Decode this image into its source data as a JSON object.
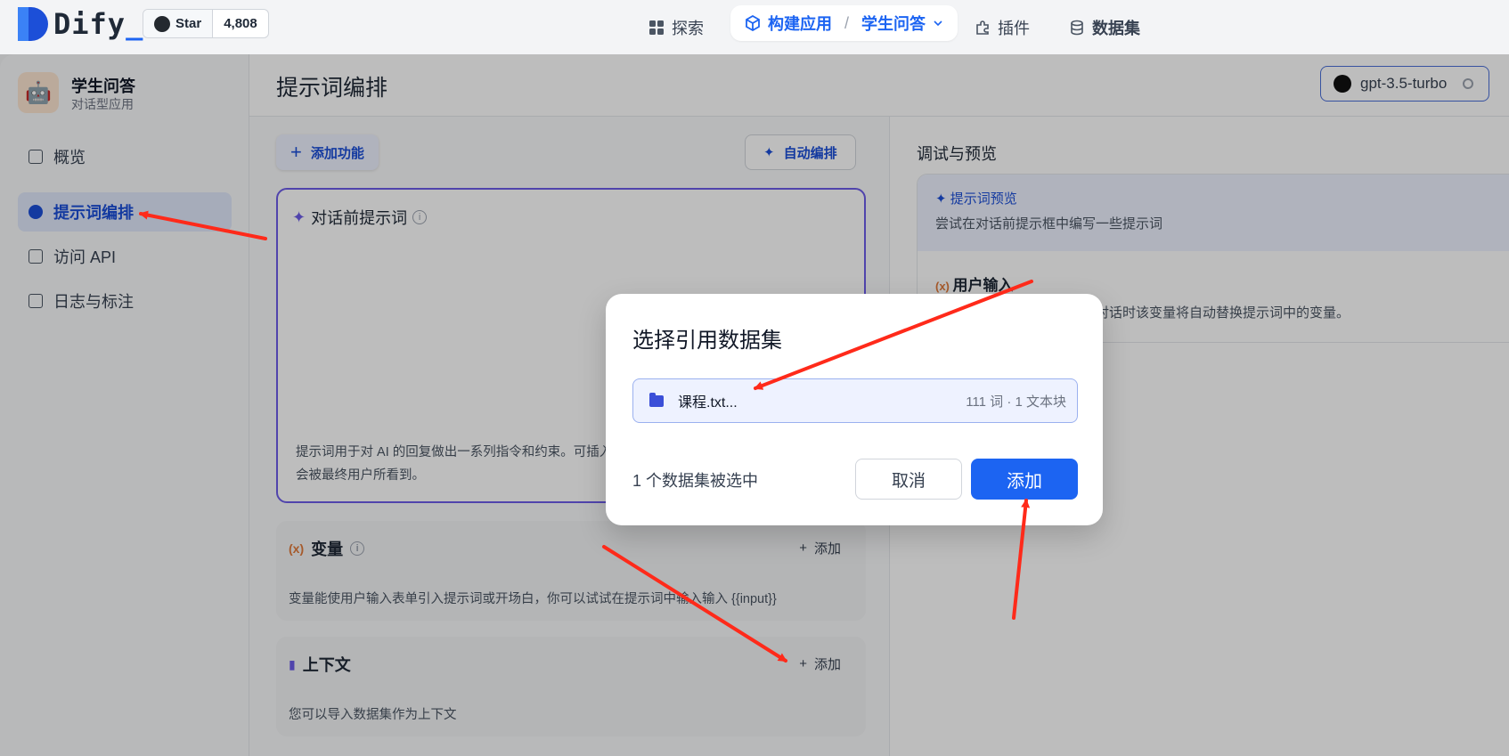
{
  "topnav": {
    "logo_text": "Dify",
    "github_star_label": "Star",
    "github_star_count": "4,808",
    "explore": "探索",
    "build_app": "构建应用",
    "current_app": "学生问答",
    "plugins": "插件",
    "datasets": "数据集"
  },
  "sidebar": {
    "app_name": "学生问答",
    "app_type": "对话型应用",
    "items": [
      {
        "label": "概览",
        "icon": "chart-icon"
      },
      {
        "label": "提示词编排",
        "icon": "gear-icon",
        "active": true
      },
      {
        "label": "访问 API",
        "icon": "terminal-icon"
      },
      {
        "label": "日志与标注",
        "icon": "document-icon"
      }
    ]
  },
  "main": {
    "title": "提示词编排",
    "model": "gpt-3.5-turbo",
    "add_feature": "添加功能",
    "auto_arrange": "自动编排",
    "prompt": {
      "title": "对话前提示词",
      "help": "提示词用于对 AI 的回复做出一系列指令和约束。可插入表单变量，例如 {{input}}。这段提示词不会被最终用户所看到。"
    },
    "variables": {
      "title": "变量",
      "add": "添加",
      "desc": "变量能使用户输入表单引入提示词或开场白，你可以试试在提示词中输入输入 {{input}}"
    },
    "context": {
      "title": "上下文",
      "add": "添加",
      "desc": "您可以导入数据集作为上下文"
    }
  },
  "preview": {
    "title": "调试与预览",
    "prompt_preview": "提示词预览",
    "prompt_hint": "尝试在对话前提示框中编写一些提示词",
    "user_input": "用户输入",
    "user_input_desc": "对话时该变量将自动替换提示词中的变量。"
  },
  "dialog": {
    "title": "选择引用数据集",
    "dataset_name": "课程.txt...",
    "dataset_meta": "111 词 · 1 文本块",
    "selected_count": "1 个数据集被选中",
    "cancel": "取消",
    "add": "添加"
  },
  "colors": {
    "accent": "#1c64f2",
    "annotation_arrow": "#ff2a1a",
    "prompt_border": "#6d5ce8"
  }
}
